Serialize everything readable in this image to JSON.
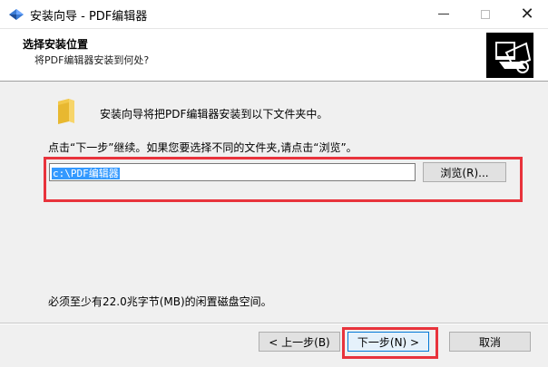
{
  "window": {
    "title": "安装向导 - PDF编辑器",
    "minimize_label": "—",
    "maximize_label": "□",
    "close_label": "✕"
  },
  "header": {
    "title": "选择安装位置",
    "subtitle": "将PDF编辑器安装到何处?"
  },
  "body": {
    "intro": "安装向导将把PDF编辑器安装到以下文件夹中。",
    "instruction": "点击“下一步”继续。如果您要选择不同的文件夹,请点击“浏览”。",
    "install_path": "c:\\PDF编辑器",
    "browse_label": "浏览(R)...",
    "disk_space": "必须至少有22.0兆字节(MB)的闲置磁盘空间。"
  },
  "buttons": {
    "back": "< 上一步(B)",
    "next": "下一步(N) >",
    "cancel": "取消"
  },
  "colors": {
    "highlight": "#e8333c",
    "selection": "#3399ff",
    "accent": "#0078d7"
  },
  "icons": {
    "app": "installer-icon",
    "header": "computer-box-icon",
    "folder": "folder-icon"
  }
}
